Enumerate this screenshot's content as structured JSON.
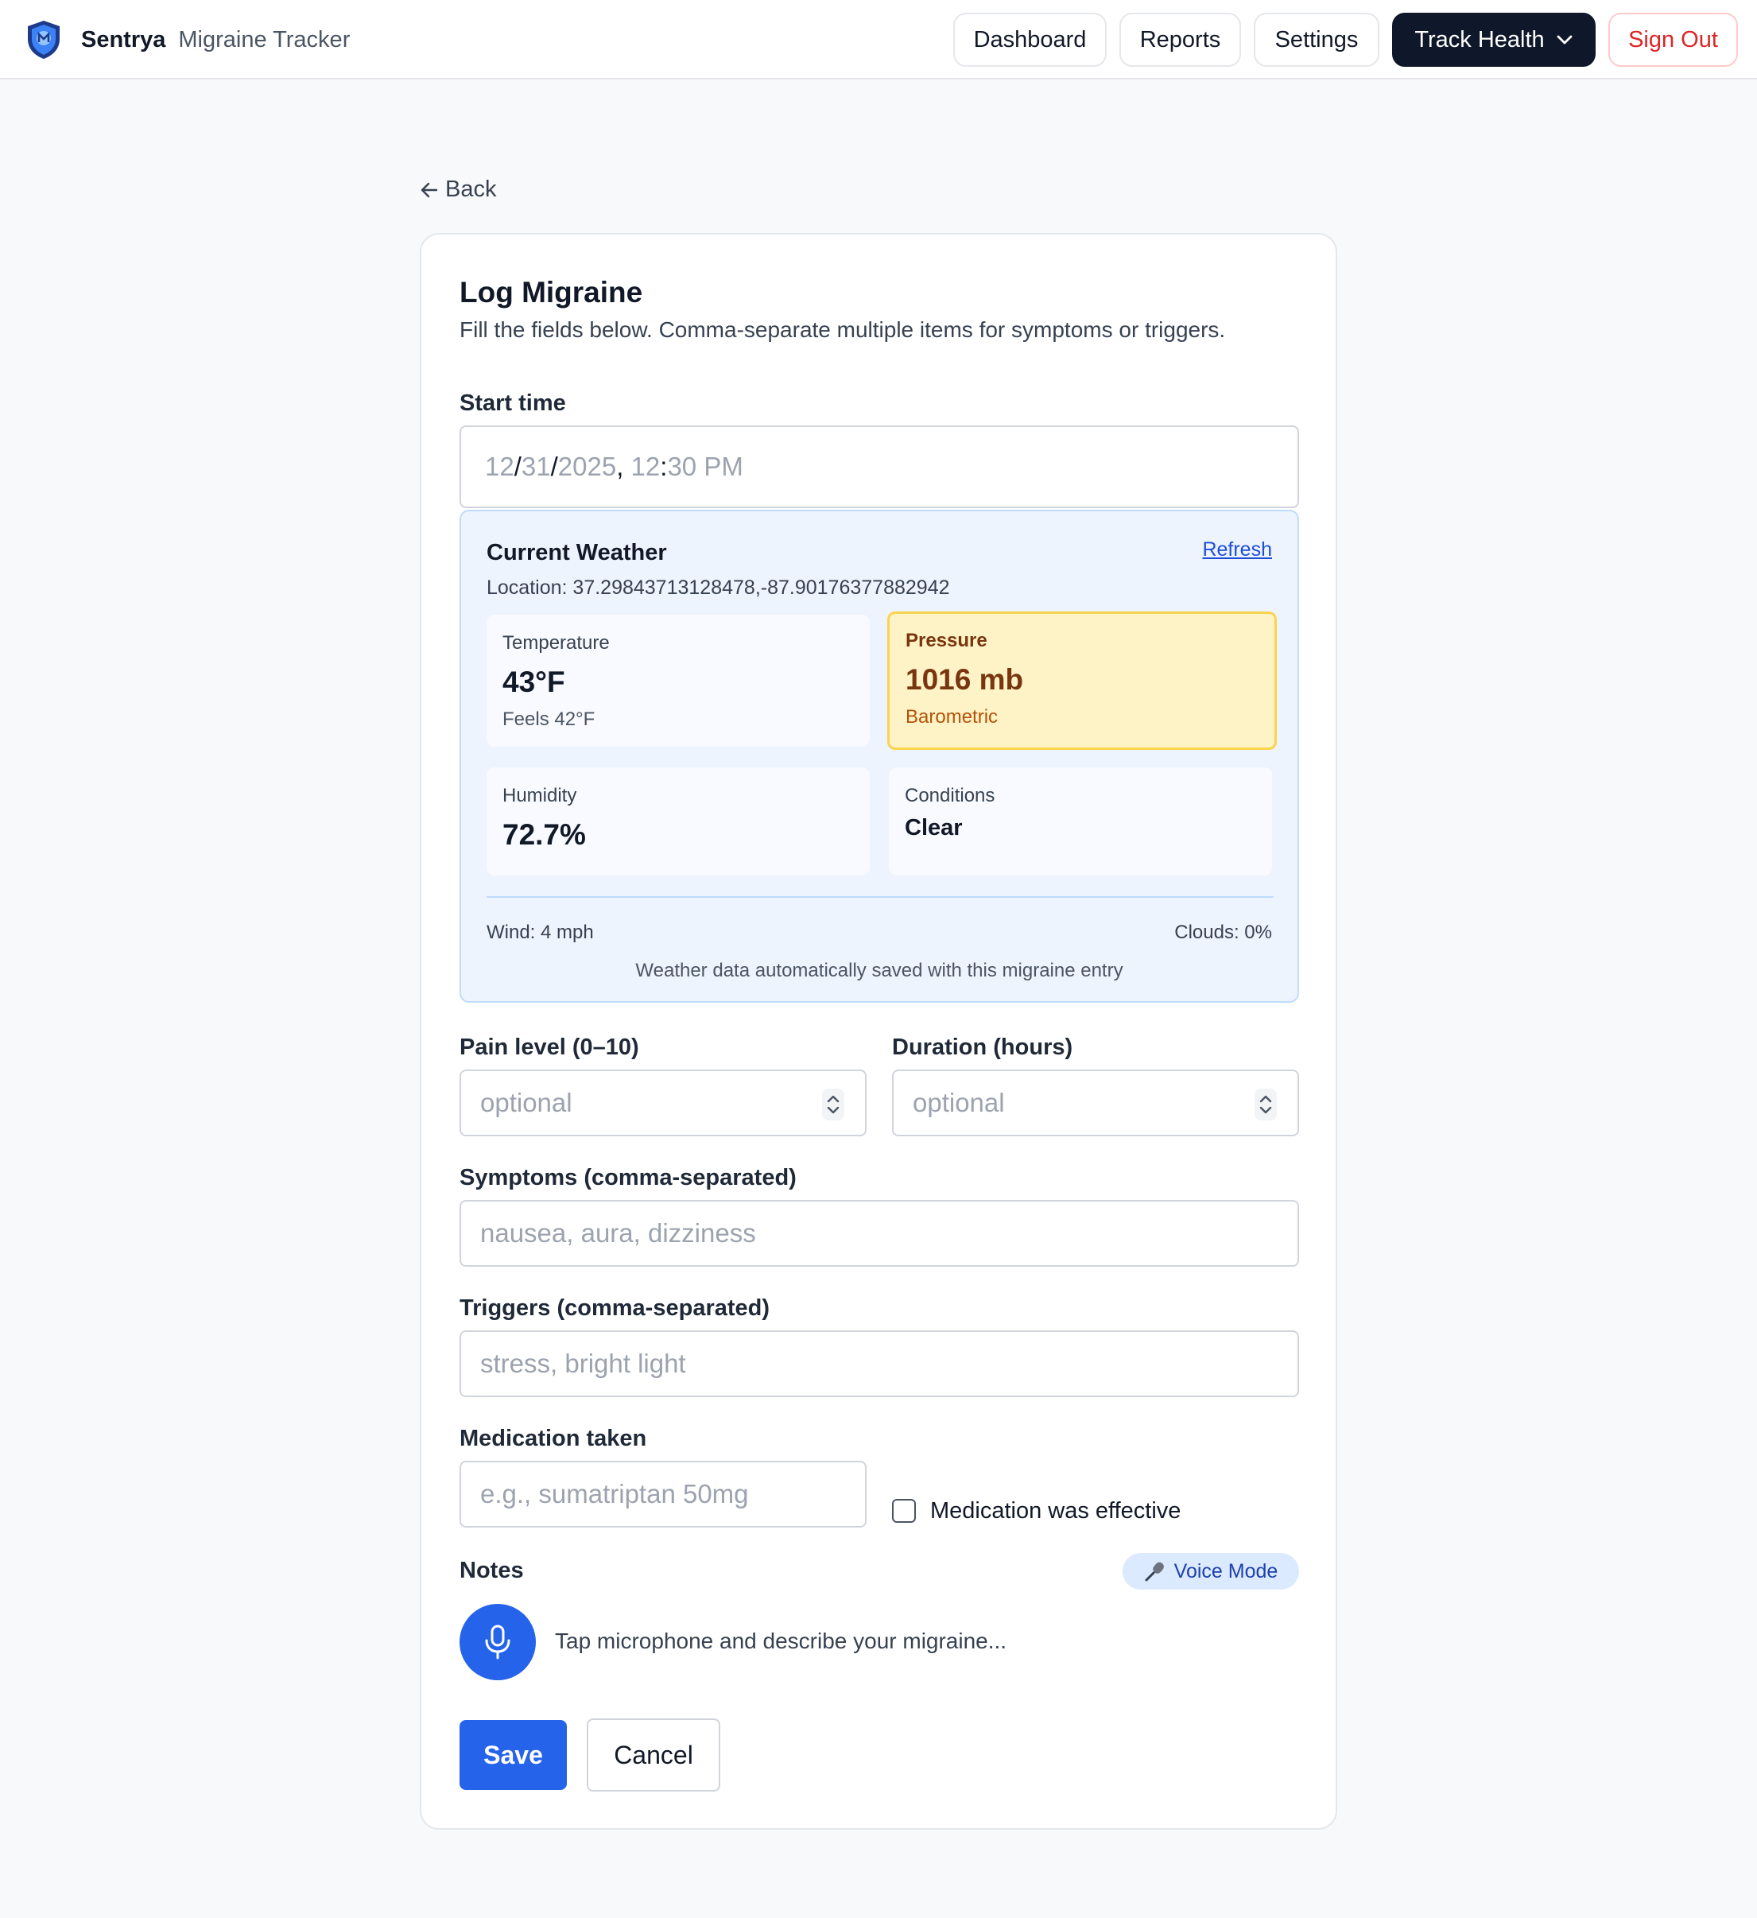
{
  "nav": {
    "brand_name": "Sentrya",
    "brand_subtitle": "Migraine Tracker",
    "dashboard": "Dashboard",
    "reports": "Reports",
    "settings": "Settings",
    "track_health": "Track Health",
    "sign_out": "Sign Out"
  },
  "back_label": "Back",
  "form": {
    "title": "Log Migraine",
    "subtitle": "Fill the fields below. Comma-separate multiple items for symptoms or triggers.",
    "start_time": {
      "label": "Start time",
      "month": "12",
      "day": "31",
      "year": "2025",
      "hour": "12",
      "minute": "30",
      "ampm": "PM"
    },
    "weather": {
      "title": "Current Weather",
      "refresh": "Refresh",
      "location": "Location: 37.29843713128478,-87.90176377882942",
      "temperature": {
        "label": "Temperature",
        "value": "43°F",
        "sub": "Feels 42°F"
      },
      "pressure": {
        "label": "Pressure",
        "value": "1016 mb",
        "sub": "Barometric"
      },
      "humidity": {
        "label": "Humidity",
        "value": "72.7%"
      },
      "conditions": {
        "label": "Conditions",
        "value": "Clear"
      },
      "wind": "Wind: 4 mph",
      "clouds": "Clouds: 0%",
      "saved_note": "Weather data automatically saved with this migraine entry"
    },
    "pain_level": {
      "label": "Pain level (0–10)",
      "placeholder": "optional"
    },
    "duration": {
      "label": "Duration (hours)",
      "placeholder": "optional"
    },
    "symptoms": {
      "label": "Symptoms (comma-separated)",
      "placeholder": "nausea, aura, dizziness"
    },
    "triggers": {
      "label": "Triggers (comma-separated)",
      "placeholder": "stress, bright light"
    },
    "medication": {
      "label": "Medication taken",
      "placeholder": "e.g., sumatriptan 50mg",
      "effective_label": "Medication was effective",
      "effective_checked": false
    },
    "notes": {
      "label": "Notes",
      "voice_mode": "Voice Mode",
      "mic_prompt": "Tap microphone and describe your migraine..."
    },
    "save": "Save",
    "cancel": "Cancel"
  },
  "colors": {
    "primary": "#2563eb",
    "dark": "#0f172a",
    "danger": "#dc2626",
    "pressure_bg": "#fef3c7",
    "pressure_border": "#fcd34d",
    "weather_bg": "#eef4fd"
  },
  "icons": {
    "brand": "shield-logo-icon",
    "dropdown": "chevron-down-icon",
    "back": "arrow-left-icon",
    "stepper": "up-down-stepper-icon",
    "mic": "microphone-icon",
    "voice": "microphone-emoji-icon"
  }
}
